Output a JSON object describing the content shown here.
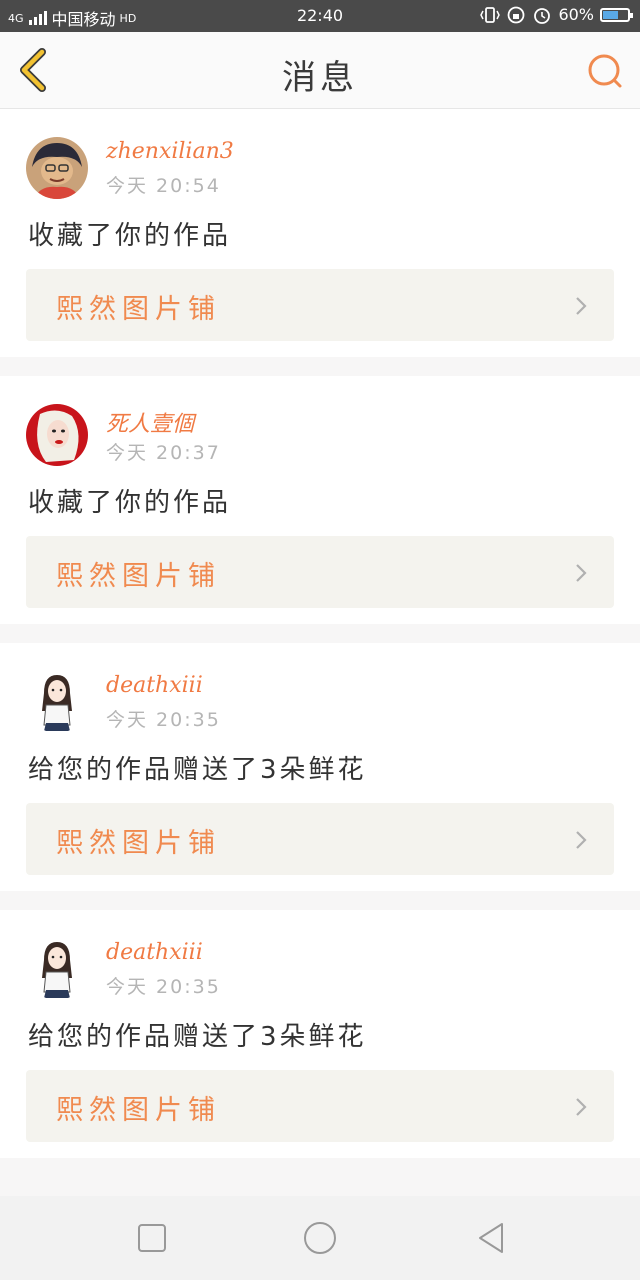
{
  "status_bar": {
    "network": "4G",
    "carrier": "中国移动",
    "hd": "HD",
    "time": "22:40",
    "battery": "60%",
    "battery_level": 0.6
  },
  "header": {
    "title": "消息",
    "back_icon": "back-chevron-icon",
    "search_icon": "search-icon"
  },
  "colors": {
    "accent": "#f07a43",
    "back": "#f2c232"
  },
  "messages": [
    {
      "user": "zhenxilian3",
      "time": "今天  20:54",
      "text": "收藏了你的作品",
      "work": "熙然图片铺"
    },
    {
      "user": "死人壹個",
      "time": "今天  20:37",
      "text": "收藏了你的作品",
      "work": "熙然图片铺"
    },
    {
      "user": "deathxiii",
      "time": "今天  20:35",
      "text": "给您的作品赠送了3朵鲜花",
      "work": "熙然图片铺"
    },
    {
      "user": "deathxiii",
      "time": "今天  20:35",
      "text": "给您的作品赠送了3朵鲜花",
      "work": "熙然图片铺"
    }
  ]
}
